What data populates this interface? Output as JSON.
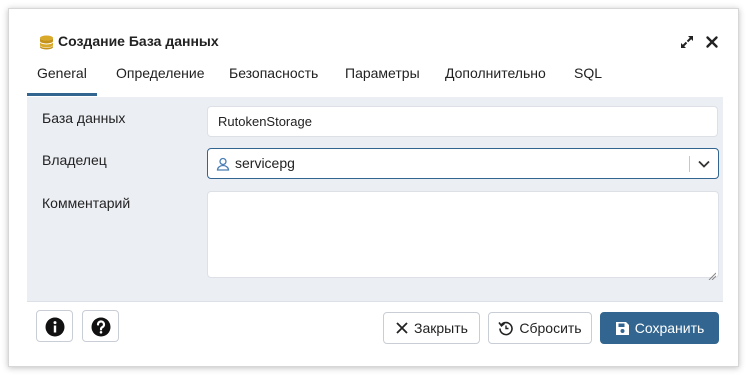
{
  "dialog": {
    "title": "Создание База данных",
    "icon": "database-icon",
    "expand_icon": "expand-icon",
    "close_icon": "close-icon"
  },
  "tabs": [
    {
      "label": "General",
      "active": true
    },
    {
      "label": "Определение",
      "active": false
    },
    {
      "label": "Безопасность",
      "active": false
    },
    {
      "label": "Параметры",
      "active": false
    },
    {
      "label": "Дополнительно",
      "active": false
    },
    {
      "label": "SQL",
      "active": false
    }
  ],
  "form": {
    "database": {
      "label": "База данных",
      "value": "RutokenStorage"
    },
    "owner": {
      "label": "Владелец",
      "value": "servicepg",
      "icon": "user-icon"
    },
    "comment": {
      "label": "Комментарий",
      "value": ""
    }
  },
  "footer": {
    "info_icon": "info-icon",
    "help_icon": "help-icon",
    "close_label": "Закрыть",
    "reset_label": "Сбросить",
    "save_label": "Сохранить"
  },
  "colors": {
    "primary": "#326690",
    "content_bg": "#ebeef3",
    "border": "#dde0e6",
    "db_icon": "#d9a929"
  }
}
